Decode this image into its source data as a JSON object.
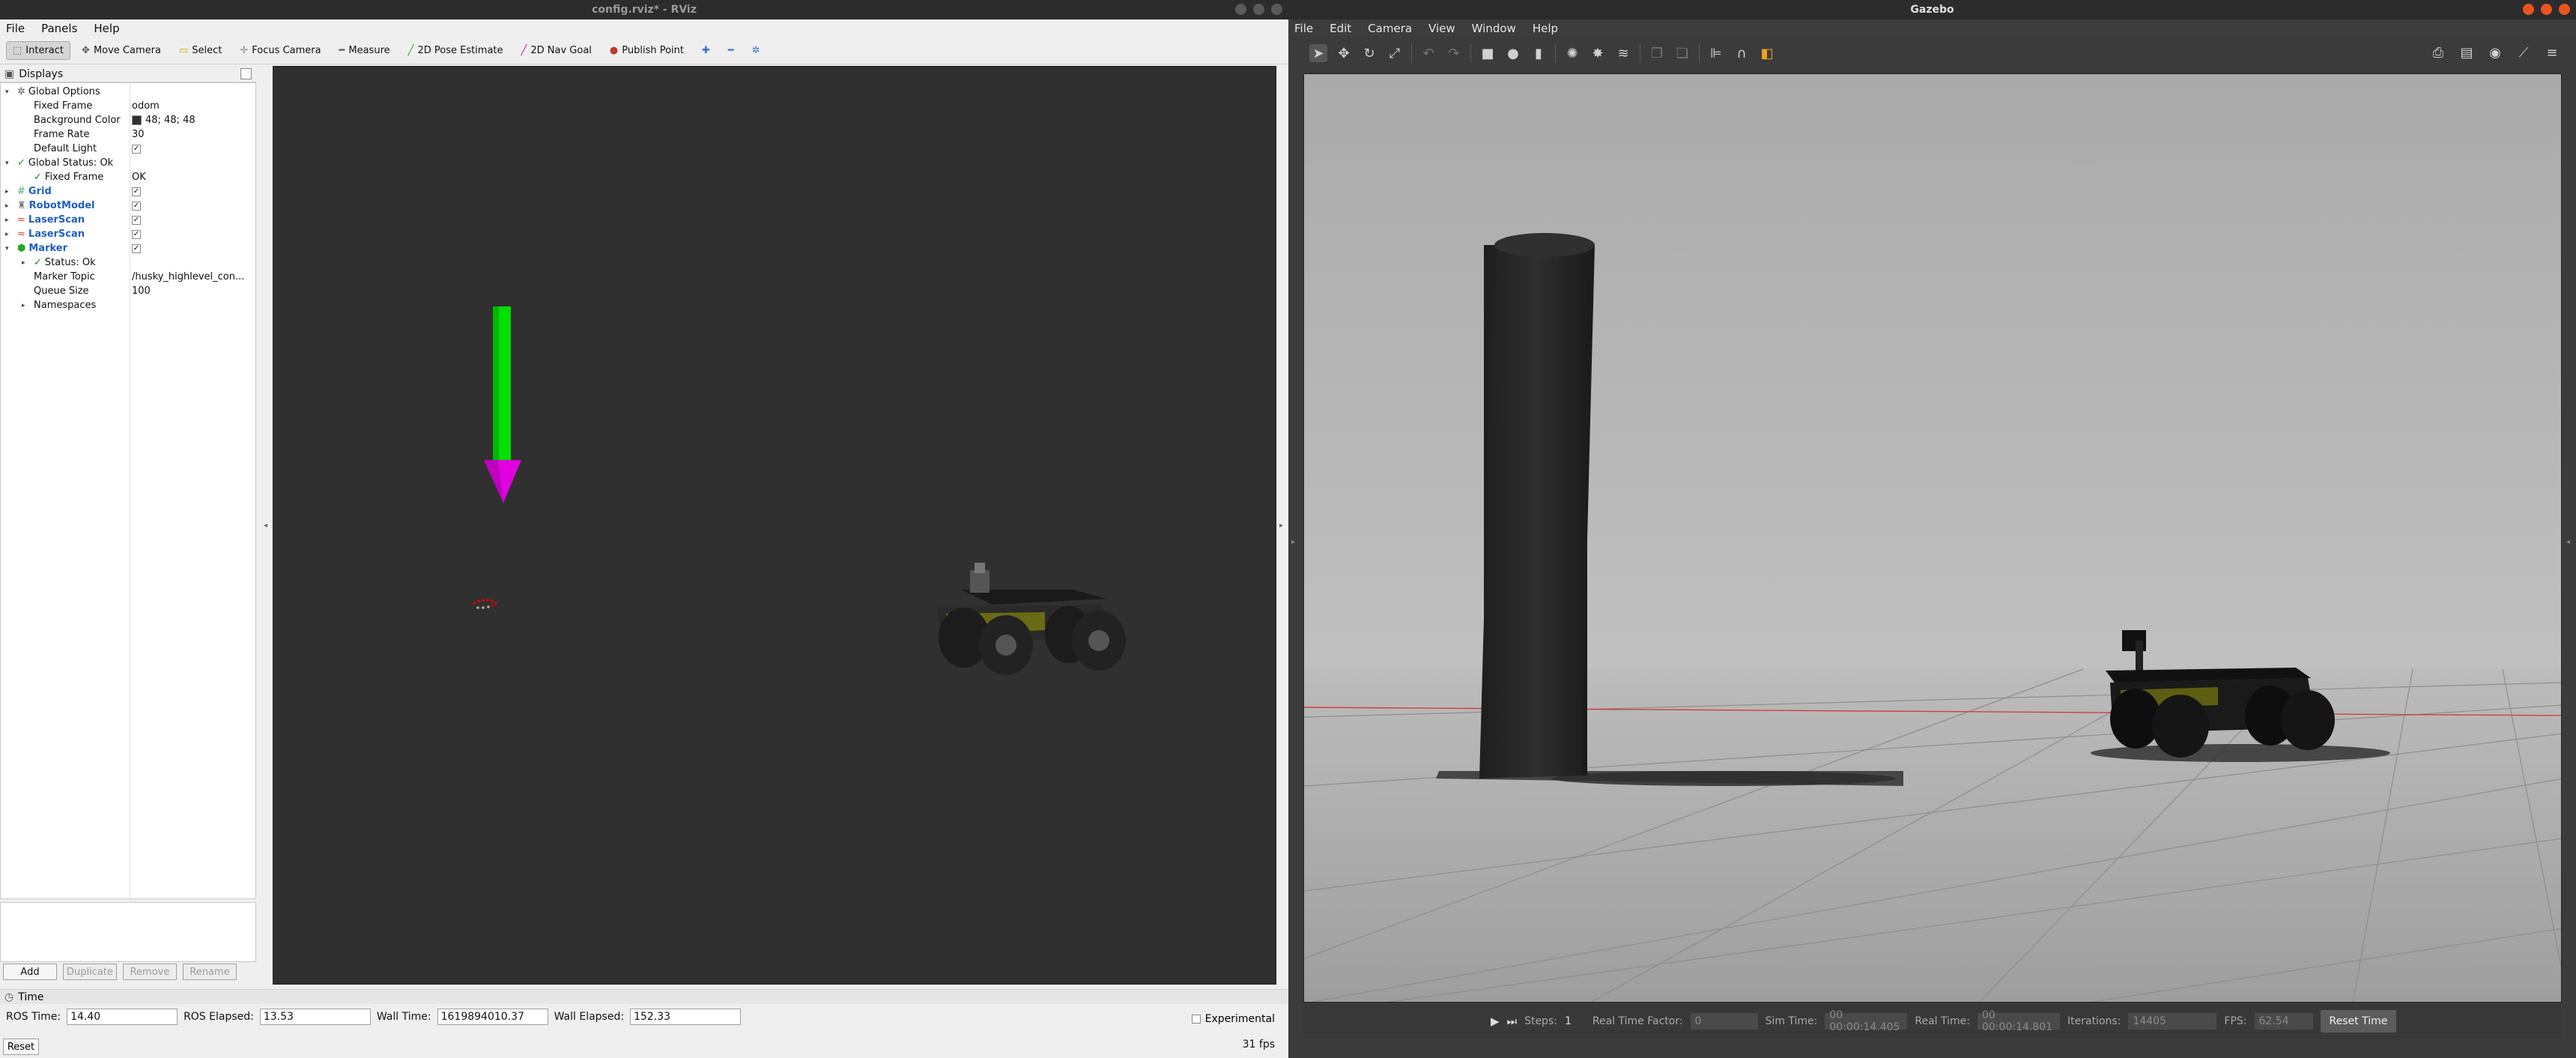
{
  "rviz": {
    "title": "config.rviz* - RViz",
    "menu": [
      "File",
      "Panels",
      "Help"
    ],
    "toolbar": [
      {
        "label": "Interact",
        "icon": "cursor-icon",
        "active": true
      },
      {
        "label": "Move Camera",
        "icon": "hand-icon",
        "active": false
      },
      {
        "label": "Select",
        "icon": "select-box-icon",
        "active": false
      },
      {
        "label": "Focus Camera",
        "icon": "focus-icon",
        "active": false
      },
      {
        "label": "Measure",
        "icon": "ruler-icon",
        "active": false
      },
      {
        "label": "2D Pose Estimate",
        "icon": "pose-arrow-icon",
        "active": false
      },
      {
        "label": "2D Nav Goal",
        "icon": "goal-arrow-icon",
        "active": false
      },
      {
        "label": "Publish Point",
        "icon": "pin-icon",
        "active": false
      }
    ],
    "displays_title": "Displays",
    "tree": [
      {
        "label": "Global Options",
        "value": ""
      },
      {
        "label": "Fixed Frame",
        "value": "odom"
      },
      {
        "label": "Background Color",
        "value": "48; 48; 48"
      },
      {
        "label": "Frame Rate",
        "value": "30"
      },
      {
        "label": "Default Light",
        "value": "✓"
      },
      {
        "label": "Global Status: Ok",
        "value": ""
      },
      {
        "label": "Fixed Frame",
        "value": "OK"
      },
      {
        "label": "Grid",
        "value": "✓"
      },
      {
        "label": "RobotModel",
        "value": "✓"
      },
      {
        "label": "LaserScan",
        "value": "✓"
      },
      {
        "label": "LaserScan",
        "value": "✓"
      },
      {
        "label": "Marker",
        "value": "✓"
      },
      {
        "label": "Status: Ok",
        "value": ""
      },
      {
        "label": "Marker Topic",
        "value": "/husky_highlevel_con..."
      },
      {
        "label": "Queue Size",
        "value": "100"
      },
      {
        "label": "Namespaces",
        "value": ""
      }
    ],
    "buttons": {
      "add": "Add",
      "duplicate": "Duplicate",
      "remove": "Remove",
      "rename": "Rename"
    },
    "time": {
      "title": "Time",
      "ros_time_label": "ROS Time:",
      "ros_time": "14.40",
      "ros_elapsed_label": "ROS Elapsed:",
      "ros_elapsed": "13.53",
      "wall_time_label": "Wall Time:",
      "wall_time": "1619894010.37",
      "wall_elapsed_label": "Wall Elapsed:",
      "wall_elapsed": "152.33",
      "experimental": "Experimental",
      "fps": "31 fps",
      "reset": "Reset"
    }
  },
  "gazebo": {
    "title": "Gazebo",
    "menu": [
      "File",
      "Edit",
      "Camera",
      "View",
      "Window",
      "Help"
    ],
    "bottom": {
      "steps_label": "Steps:",
      "steps": "1",
      "rtf_label": "Real Time Factor:",
      "rtf": "0",
      "sim_time_label": "Sim Time:",
      "sim_time": "00 00:00:14.405",
      "real_time_label": "Real Time:",
      "real_time": "00 00:00:14.801",
      "iterations_label": "Iterations:",
      "iterations": "14405",
      "fps_label": "FPS:",
      "fps": "62.54",
      "reset_time": "Reset Time"
    }
  },
  "colors": {
    "rviz_bg": "#303030",
    "marker_shaft": "#00e000",
    "marker_head": "#e000e0",
    "accent": "#e95420"
  }
}
